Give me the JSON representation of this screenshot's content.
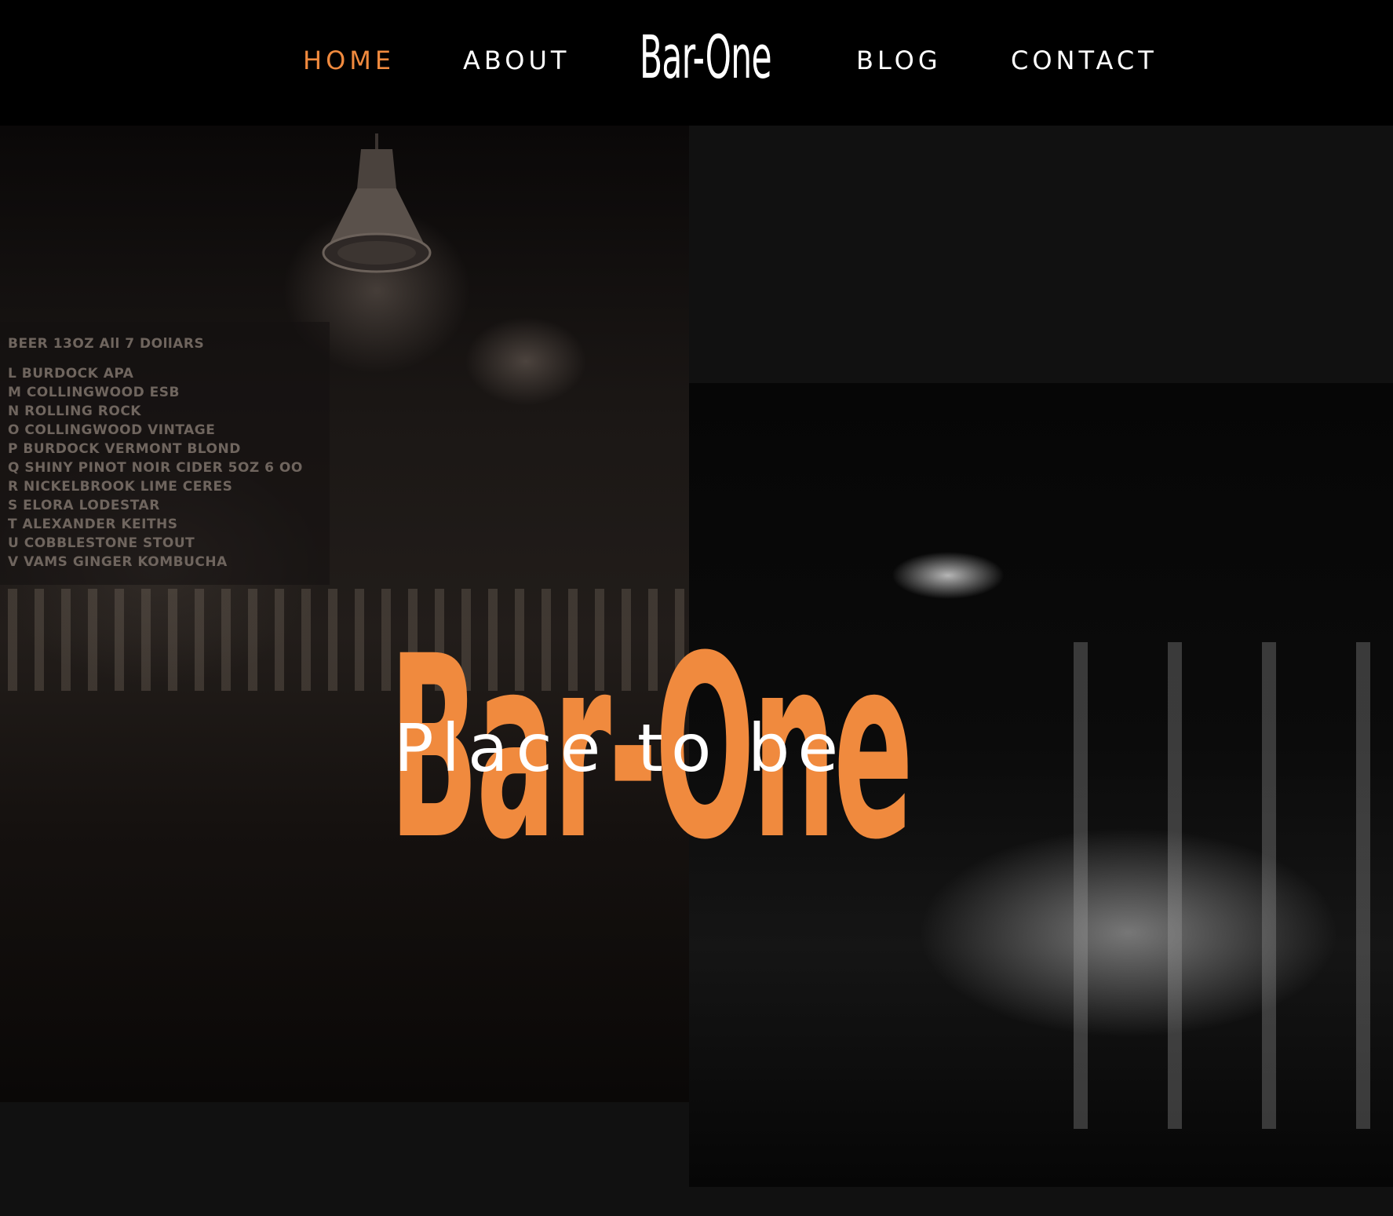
{
  "nav": {
    "items": [
      {
        "label": "HOME",
        "active": true
      },
      {
        "label": "ABOUT",
        "active": false
      },
      {
        "label": "BLOG",
        "active": false
      },
      {
        "label": "CONTACT",
        "active": false
      }
    ],
    "logo": "Bar-One"
  },
  "hero": {
    "title": "Bar-One",
    "subtitle": "Place to be"
  },
  "menu_board": {
    "lines": [
      "BEER          13OZ    All 7 DOllARS",
      "L  BURDOCK   APA",
      "M COLLINGWOOD  ESB",
      "N  ROLLING ROCK",
      "O COLLINGWOOD  VINTAGE",
      "P  BURDOCK VERMONT BLOND",
      "Q  SHINY PINOT NOIR CIDER  5OZ     6 OO",
      "R  NICKELBROOK  LIME  CERES",
      "S  ELORA LODESTAR",
      "T ALEXANDER  KEITHS",
      "U COBBLESTONE  STOUT",
      "V  VAMS  GINGER  KOMBUCHA"
    ]
  },
  "colors": {
    "accent": "#f08a3e",
    "background": "#111111",
    "nav_background": "#000000",
    "text": "#ffffff"
  }
}
